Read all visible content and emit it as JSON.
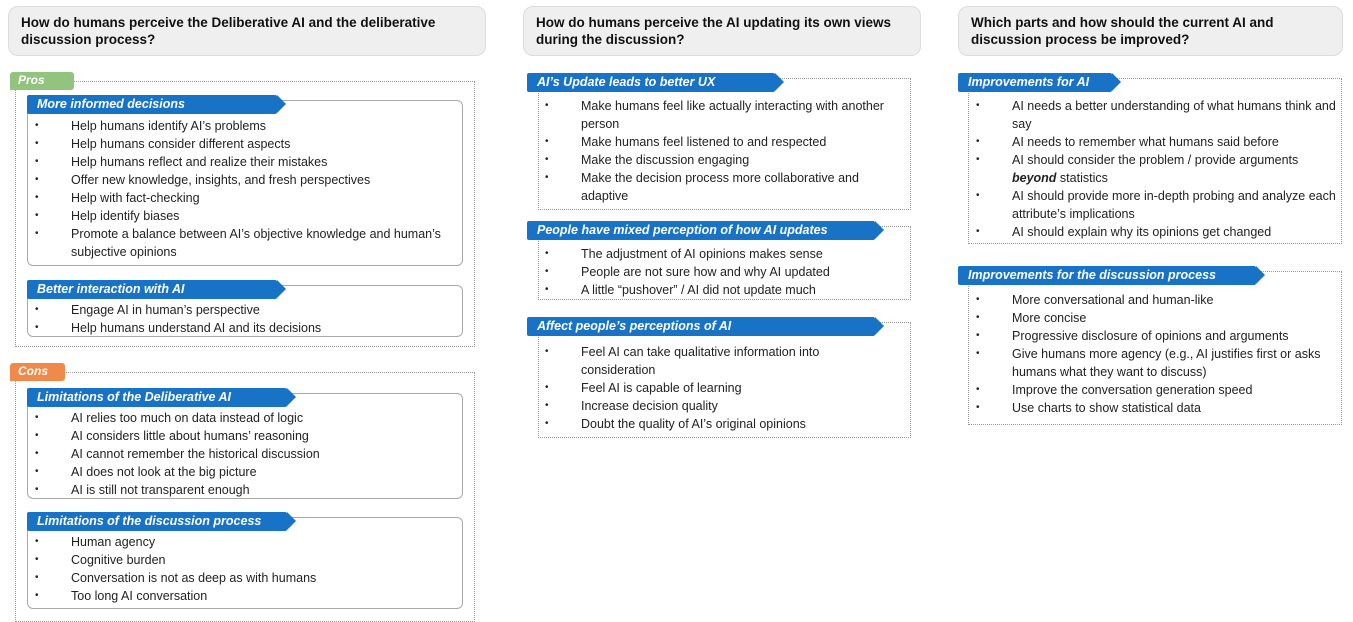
{
  "columns": [
    {
      "question": "How do humans perceive the Deliberative AI and the deliberative discussion process?",
      "groups": [
        {
          "label": "Pros",
          "sections": [
            {
              "title": "More informed decisions",
              "items": [
                "Help humans identify AI’s problems",
                "Help humans consider different aspects",
                "Help humans reflect and realize their mistakes",
                "Offer new knowledge, insights, and fresh perspectives",
                "Help with fact-checking",
                "Help identify biases",
                "Promote a balance between AI’s objective knowledge and human’s subjective opinions"
              ]
            },
            {
              "title": "Better interaction with AI",
              "items": [
                "Engage AI in human’s perspective",
                "Help humans understand AI and its decisions"
              ]
            }
          ]
        },
        {
          "label": "Cons",
          "sections": [
            {
              "title": "Limitations of the Deliberative AI",
              "items": [
                "AI relies too much on data instead of logic",
                "AI considers little about humans’ reasoning",
                "AI cannot remember the historical discussion",
                "AI does not look at the big picture",
                "AI is still not transparent enough"
              ]
            },
            {
              "title": "Limitations of the discussion process",
              "items": [
                "Human agency",
                "Cognitive burden",
                "Conversation is not as deep as with humans",
                "Too long AI conversation"
              ]
            }
          ]
        }
      ]
    },
    {
      "question": "How do humans perceive the AI updating its own views during the discussion?",
      "sections": [
        {
          "title": "AI’s Update leads to better UX",
          "items": [
            "Make humans feel like actually interacting with another person",
            "Make humans feel listened to and respected",
            "Make the discussion engaging",
            "Make the decision process more collaborative and adaptive"
          ]
        },
        {
          "title": "People have mixed perception of how AI updates",
          "items": [
            "The adjustment of AI opinions makes sense",
            "People are not sure how and why AI updated",
            "A little “pushover” / AI did not update much"
          ]
        },
        {
          "title": "Affect people’s perceptions of AI",
          "items": [
            "Feel AI can take qualitative information into consideration",
            "Feel AI is capable of learning",
            "Increase decision quality",
            "Doubt the quality of AI’s original opinions"
          ]
        }
      ]
    },
    {
      "question": "Which parts and how should the current AI and discussion process be improved?",
      "sections": [
        {
          "title": "Improvements for AI",
          "items": [
            "AI needs a better understanding of what humans think and say",
            "AI needs to remember what humans said before",
            "AI should consider the problem / provide arguments",
            "AI should provide more in-depth probing and analyze each attribute’s implications",
            "AI should explain why its opinions get changed"
          ],
          "item3_emph": "beyond",
          "item3_tail": " statistics"
        },
        {
          "title": "Improvements for the discussion process",
          "items": [
            "More conversational and human-like",
            "More concise",
            "Progressive disclosure of opinions and arguments",
            "Give humans more agency (e.g., AI justifies first or asks humans what they want to discuss)",
            "Improve the conversation generation speed",
            "Use charts to show statistical data"
          ]
        }
      ]
    }
  ]
}
